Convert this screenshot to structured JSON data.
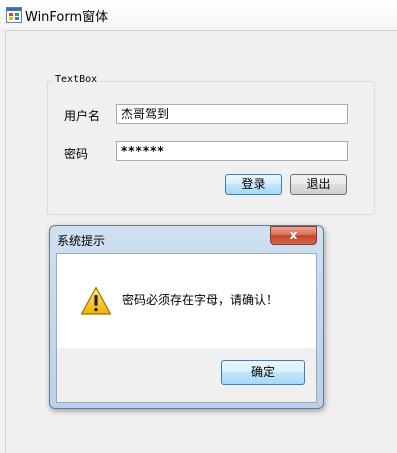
{
  "main_window": {
    "title": "WinForm窗体",
    "groupbox_title": "TextBox",
    "username_label": "用户名",
    "username_value": "杰哥驾到",
    "password_label": "密码",
    "password_value": "******",
    "login_button": "登录",
    "exit_button": "退出"
  },
  "message_box": {
    "title": "系统提示",
    "close_glyph": "x",
    "message": "密码必须存在字母，请确认！",
    "ok_button": "确定"
  },
  "icons": {
    "app": "winform-app-icon",
    "warning": "warning-icon",
    "close": "close-icon"
  },
  "colors": {
    "titlebar": "#ffffff",
    "close_button": "#c6442a",
    "dialog_frame": "#b9d1ea",
    "default_button_border": "#3c7fb1"
  }
}
